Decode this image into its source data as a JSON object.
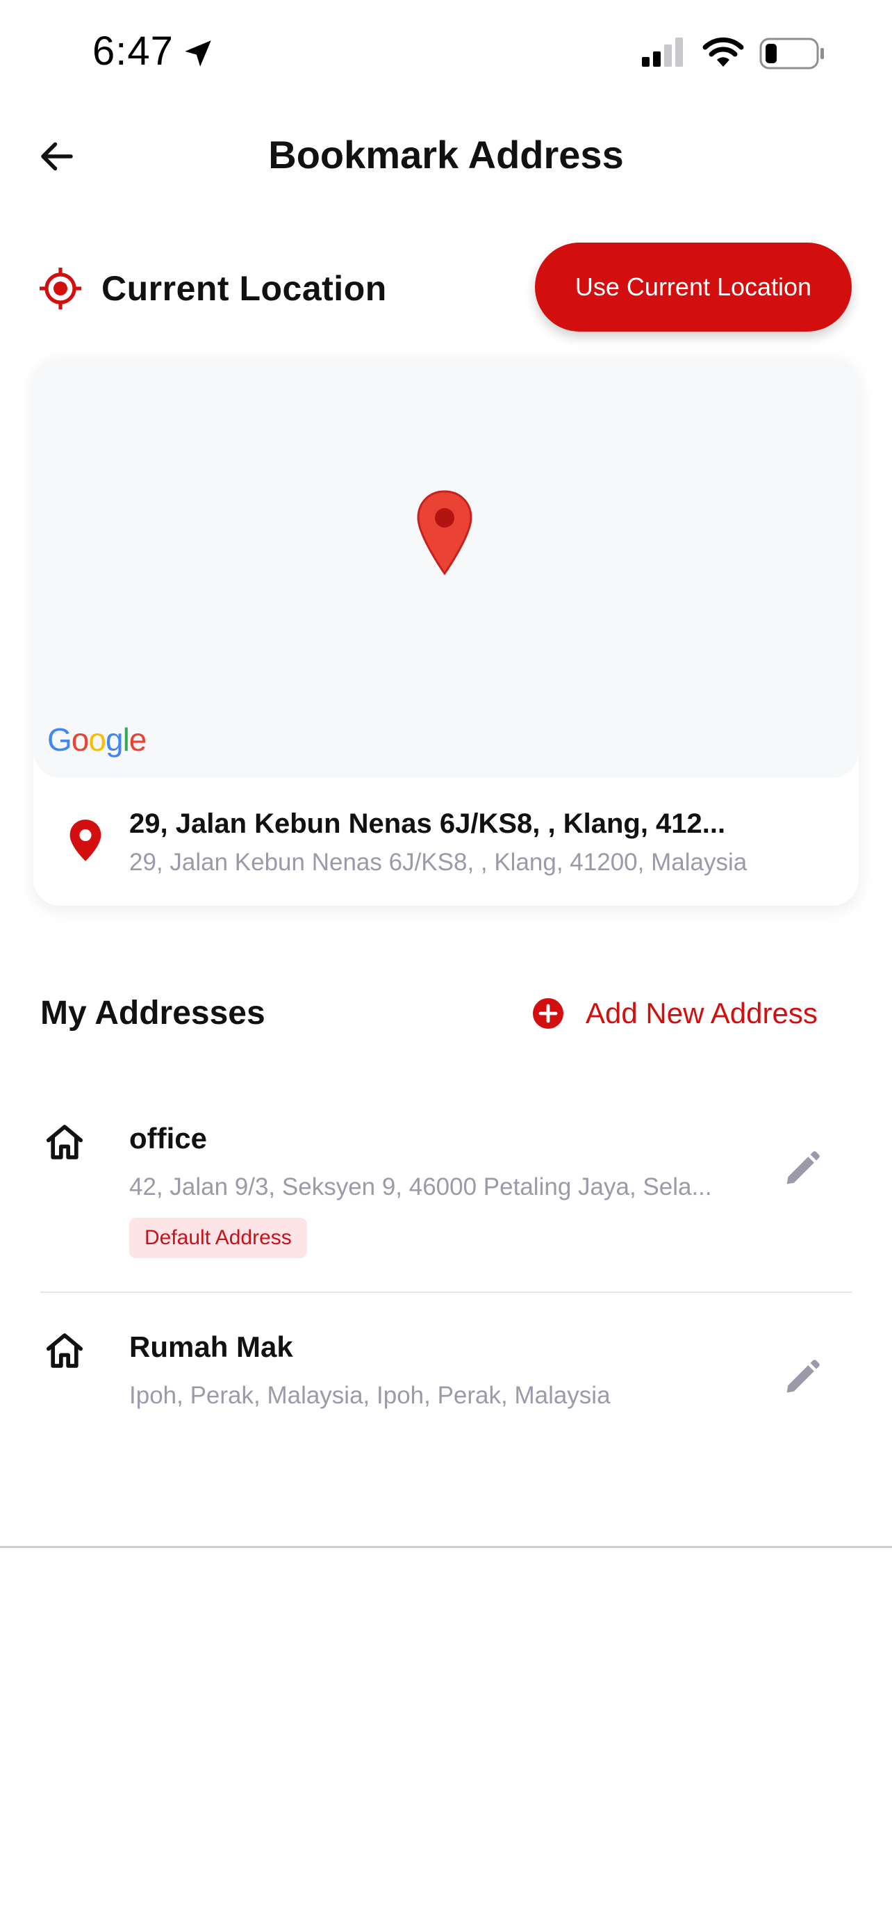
{
  "status_bar": {
    "time": "6:47"
  },
  "header": {
    "title": "Bookmark Address"
  },
  "current_location": {
    "label": "Current Location",
    "button_label": "Use Current Location"
  },
  "map": {
    "provider_logo": "Google",
    "address_title": "29, Jalan Kebun Nenas 6J/KS8, , Klang, 412...",
    "address_full": "29, Jalan Kebun Nenas 6J/KS8, , Klang, 41200, Malaysia"
  },
  "my_addresses": {
    "title": "My Addresses",
    "add_label": "Add New Address",
    "items": [
      {
        "name": "office",
        "address": "42, Jalan 9/3, Seksyen 9, 46000 Petaling Jaya, Sela...",
        "badge": "Default Address"
      },
      {
        "name": "Rumah Mak",
        "address": "Ipoh, Perak, Malaysia, Ipoh, Perak, Malaysia"
      }
    ]
  },
  "colors": {
    "accent": "#d30e0e",
    "muted_text": "#9a9aaa",
    "badge_bg": "#fde4e6"
  },
  "icons": [
    "location-arrow-icon",
    "signal-icon",
    "wifi-icon",
    "battery-icon",
    "back-arrow-icon",
    "target-icon",
    "map-pin-icon",
    "plus-circle-icon",
    "home-icon",
    "edit-pencil-icon"
  ]
}
